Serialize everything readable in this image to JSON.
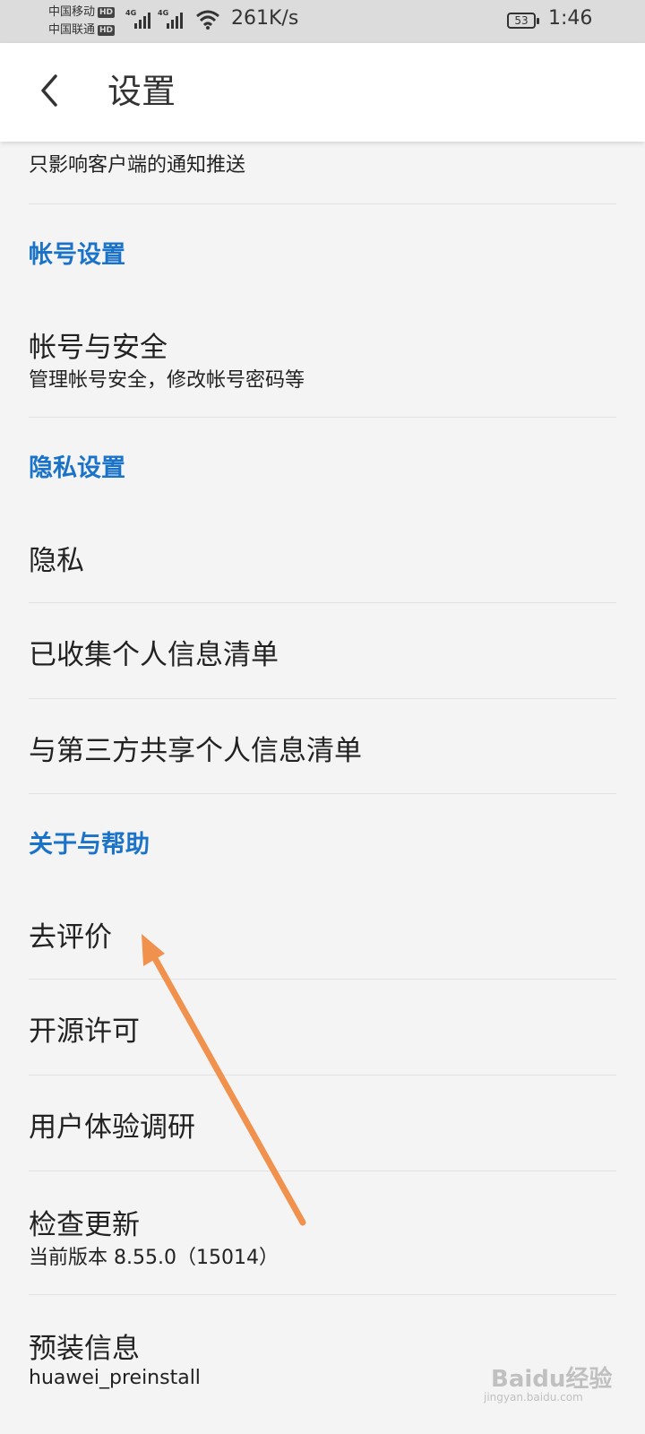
{
  "status_bar": {
    "carrier1": "中国移动",
    "carrier2": "中国联通",
    "hd_badge": "HD",
    "network_type": "4G",
    "net_speed": "261K/s",
    "battery": "53",
    "time": "1:46",
    "icons": [
      "signal-icon",
      "wifi-icon",
      "battery-icon"
    ]
  },
  "app_bar": {
    "back_icon": "chevron-left-icon",
    "title": "设置"
  },
  "list": {
    "partial_item": {
      "title": "",
      "subtitle": "只影响客户端的通知推送"
    },
    "account_section": "帐号设置",
    "account_security": {
      "title": "帐号与安全",
      "subtitle": "管理帐号安全，修改帐号密码等"
    },
    "privacy_section": "隐私设置",
    "privacy": "隐私",
    "collected_info": "已收集个人信息清单",
    "third_party_info": "与第三方共享个人信息清单",
    "about_section": "关于与帮助",
    "rate": "去评价",
    "open_source": "开源许可",
    "ux_survey": "用户体验调研",
    "check_update": {
      "title": "检查更新",
      "subtitle": "当前版本 8.55.0（15014）"
    },
    "preinstall": {
      "title": "预装信息",
      "subtitle": "huawei_preinstall"
    }
  },
  "watermark": {
    "text": "Baidu经验",
    "sub": "jingyan.baidu.com"
  },
  "colors": {
    "section_header": "#1a73c8",
    "annotation_arrow": "#f0924e",
    "background": "#f4f4f4"
  }
}
